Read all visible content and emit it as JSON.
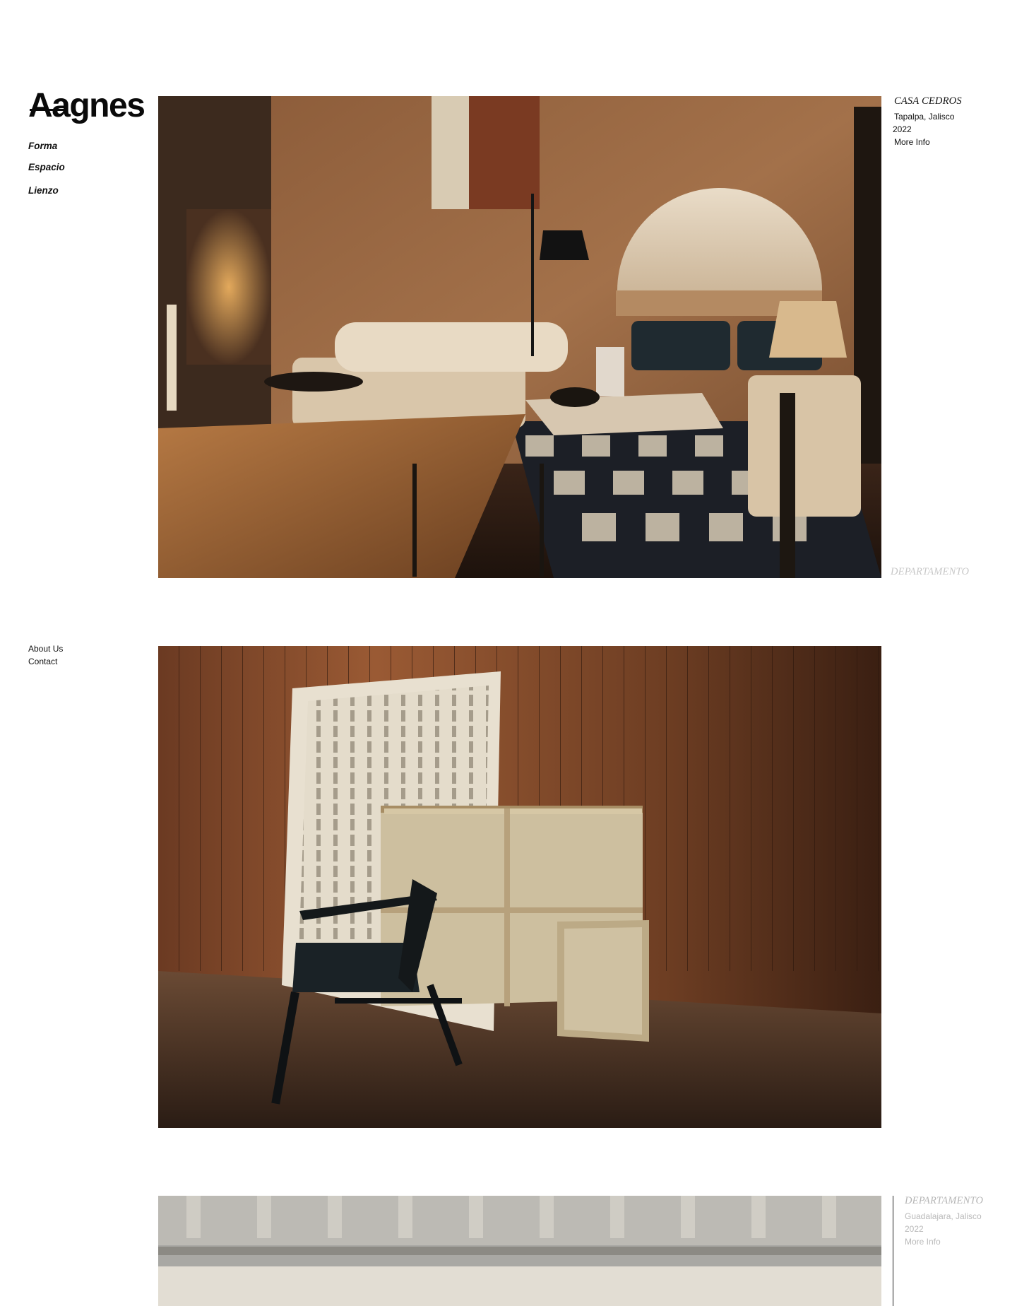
{
  "brand": {
    "logo": "Aagnes"
  },
  "nav": {
    "items": [
      {
        "label": "Forma"
      },
      {
        "label": "Espacio"
      },
      {
        "label": "Lienzo"
      }
    ]
  },
  "footer_nav": {
    "items": [
      {
        "label": "About Us"
      },
      {
        "label": "Contact"
      }
    ]
  },
  "projects": [
    {
      "title": "CASA CEDROS",
      "location": "Tapalpa, Jalisco",
      "year": "2022",
      "link": "More Info",
      "category": "DEPARTAMENTO"
    },
    {
      "title": "DEPARTAMENTO",
      "location": "Guadalajara, Jalisco",
      "year": "2022",
      "link": "More Info"
    }
  ]
}
